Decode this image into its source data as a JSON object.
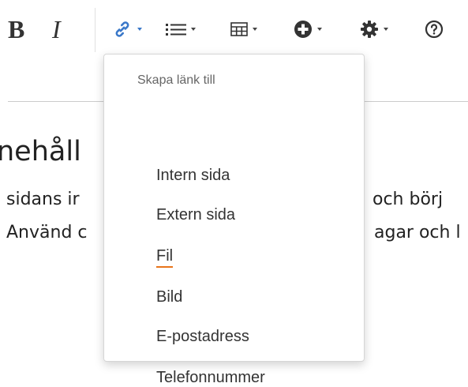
{
  "toolbar": {
    "bold_label": "B",
    "italic_label": "I",
    "buttons": [
      {
        "icon": "link-icon",
        "has_dropdown": true
      },
      {
        "icon": "list-icon",
        "has_dropdown": true
      },
      {
        "icon": "table-icon",
        "has_dropdown": true
      },
      {
        "icon": "insert-icon",
        "has_dropdown": true
      },
      {
        "icon": "gear-icon",
        "has_dropdown": true
      },
      {
        "icon": "help-icon",
        "has_dropdown": false
      }
    ],
    "link_color": "#3a78c9"
  },
  "content": {
    "heading": "nehåll",
    "line1_left": "sidans ir",
    "line1_right": "och börj",
    "line2_left": "Använd c",
    "line2_right": "agar och l"
  },
  "link_menu": {
    "header": "Skapa länk till",
    "items": [
      {
        "label": "Intern sida"
      },
      {
        "label": "Extern sida"
      },
      {
        "label": "Fil",
        "active": true
      },
      {
        "label": "Bild"
      },
      {
        "label": "E-postadress"
      },
      {
        "label": "Telefonnummer"
      }
    ],
    "active_underline_color": "#e8741a"
  }
}
